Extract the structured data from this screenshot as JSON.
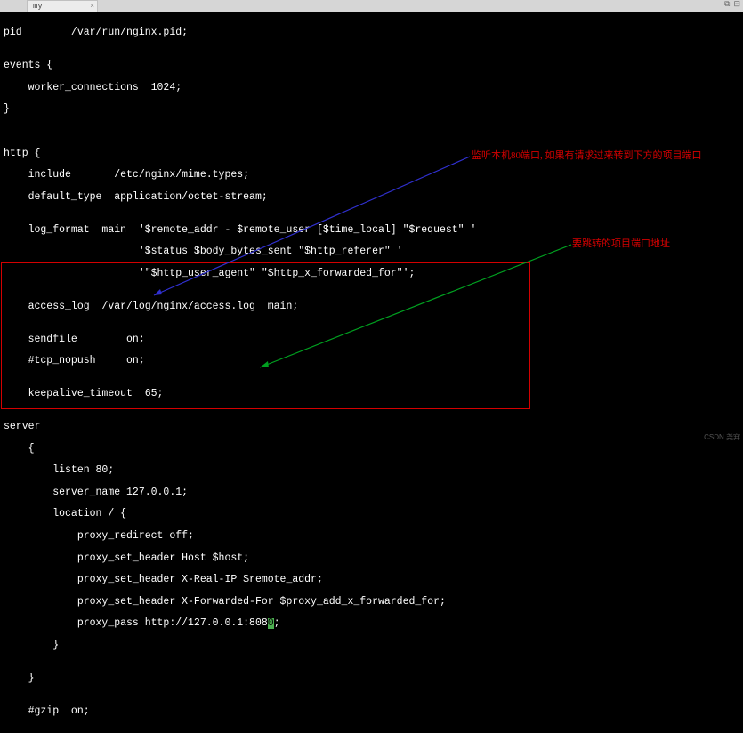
{
  "tab": {
    "title": "my",
    "close": "×"
  },
  "window_controls": {
    "collapse": "⧉",
    "split": "⊟"
  },
  "annotations": {
    "listen": "监听本机80端口, 如果有请求过来转到下方的项目端口",
    "proxy": "要跳转的项目端口地址"
  },
  "code": {
    "l1": "pid        /var/run/nginx.pid;",
    "l2": "",
    "l3": "events {",
    "l4": "    worker_connections  1024;",
    "l5": "}",
    "l6": "",
    "l7": "",
    "l8": "http {",
    "l9": "    include       /etc/nginx/mime.types;",
    "l10": "    default_type  application/octet-stream;",
    "l11": "",
    "l12": "    log_format  main  '$remote_addr - $remote_user [$time_local] \"$request\" '",
    "l13": "                      '$status $body_bytes_sent \"$http_referer\" '",
    "l14": "                      '\"$http_user_agent\" \"$http_x_forwarded_for\"';",
    "l15": "",
    "l16": "    access_log  /var/log/nginx/access.log  main;",
    "l17": "",
    "l18": "    sendfile        on;",
    "l19": "    #tcp_nopush     on;",
    "l20": "",
    "l21": "    keepalive_timeout  65;",
    "l22": "",
    "l23": "server",
    "l24": "    {",
    "l25": "        listen 80;",
    "l26": "        server_name 127.0.0.1;",
    "l27": "        location / {",
    "l28": "            proxy_redirect off;",
    "l29": "            proxy_set_header Host $host;",
    "l30": "            proxy_set_header X-Real-IP $remote_addr;",
    "l31": "            proxy_set_header X-Forwarded-For $proxy_add_x_forwarded_for;",
    "l32a": "            proxy_pass http://127.0.0.1:808",
    "l32b": "0",
    "l32c": ";",
    "l33": "        }",
    "l34": "",
    "l35": "    }",
    "l36": "",
    "l37": "    #gzip  on;"
  },
  "watermark": "CSDN 尧宑"
}
